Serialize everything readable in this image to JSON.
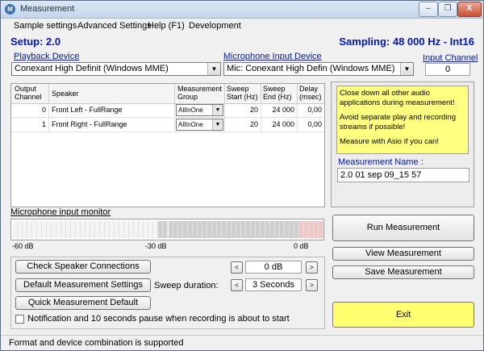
{
  "window": {
    "title": "Measurement",
    "minimize": "–",
    "restore": "❐",
    "close": "X"
  },
  "menu": {
    "items": [
      "Sample settings",
      "Advanced Settings",
      "Help (F1)",
      "Development"
    ]
  },
  "header": {
    "setup": "Setup: 2.0",
    "sampling": "Sampling: 48 000 Hz - Int16"
  },
  "devices": {
    "playback_label": "Playback Device",
    "playback_value": "Conexant High Definit (Windows MME)",
    "mic_label": "Microphone Input Device",
    "mic_value": "Mic: Conexant High Defin (Windows MME)",
    "input_channel_label": "Input Channel",
    "input_channel_value": "0"
  },
  "table": {
    "headers": [
      "Output Channel",
      "Speaker",
      "Measurement Group",
      "Sweep Start (Hz)",
      "Sweep End (Hz)",
      "Delay (msec)"
    ],
    "rows": [
      {
        "channel": "0",
        "speaker": "Front Left - FullRange",
        "group": "AllInOne",
        "start": "20",
        "end": "24 000",
        "delay": "0,00"
      },
      {
        "channel": "1",
        "speaker": "Front Right - FullRange",
        "group": "AllInOne",
        "start": "20",
        "end": "24 000",
        "delay": "0,00"
      }
    ]
  },
  "note": {
    "lines": [
      "Close down all other audio applications during measurement!",
      "Avoid separate play and recording streams if possible!",
      "Measure with Asio if you can!"
    ],
    "color": "#ffff80"
  },
  "measurement": {
    "name_label": "Measurement Name :",
    "name_value": "2.0 01 sep 09_15 57"
  },
  "monitor": {
    "label": "Microphone input monitor",
    "scale": [
      "-60 dB",
      "-30 dB",
      "0 dB"
    ],
    "level_fraction": 0
  },
  "buttons": {
    "run": "Run Measurement",
    "view": "View Measurement",
    "save": "Save Measurement",
    "exit": "Exit",
    "check_speakers": "Check Speaker Connections",
    "default_settings": "Default Measurement Settings",
    "quick_default": "Quick Measurement Default"
  },
  "controls": {
    "gain_value": "0 dB",
    "sweep_label": "Sweep duration:",
    "sweep_value": "3 Seconds",
    "left_arrow": "<",
    "right_arrow": ">",
    "notify_label": "Notification and 10 seconds pause when recording is about to start",
    "notify_checked": false
  },
  "status": {
    "text": "Format and device combination is supported"
  },
  "icons": {
    "app": "measurement-app-icon",
    "dropdown": "chevron-down-icon"
  }
}
